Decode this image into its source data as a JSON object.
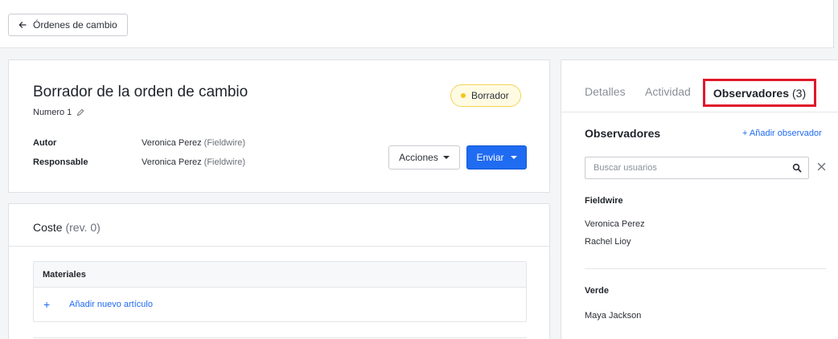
{
  "topbar": {
    "back_label": "Órdenes de cambio"
  },
  "main": {
    "title": "Borrador de la orden de cambio",
    "number_label": "Numero 1",
    "status": "Borrador",
    "author_label": "Autor",
    "author_name": "Veronica Perez",
    "author_org": "(Fieldwire)",
    "assignee_label": "Responsable",
    "assignee_name": "Veronica Perez",
    "assignee_org": "(Fieldwire)",
    "actions_label": "Acciones",
    "send_label": "Enviar"
  },
  "cost": {
    "title": "Coste",
    "revision": "(rev. 0)",
    "materials_header": "Materiales",
    "add_item_plus": "+",
    "add_item_label": "Añadir nuevo artículo"
  },
  "side": {
    "tabs": [
      {
        "label": "Detalles"
      },
      {
        "label": "Actividad"
      },
      {
        "label": "Observadores",
        "count": "(3)"
      }
    ],
    "observers_title": "Observadores",
    "add_observer": "+ Añadir observador",
    "search_placeholder": "Buscar usuarios",
    "groups": [
      {
        "name": "Fieldwire",
        "members": [
          "Veronica Perez",
          "Rachel Lioy"
        ]
      },
      {
        "name": "Verde",
        "members": [
          "Maya Jackson"
        ]
      }
    ]
  },
  "colors": {
    "accent": "#1f6bf2",
    "status_badge_bg": "#fffbe3",
    "status_dot": "#f5c518",
    "highlight_box": "#e0192b"
  }
}
